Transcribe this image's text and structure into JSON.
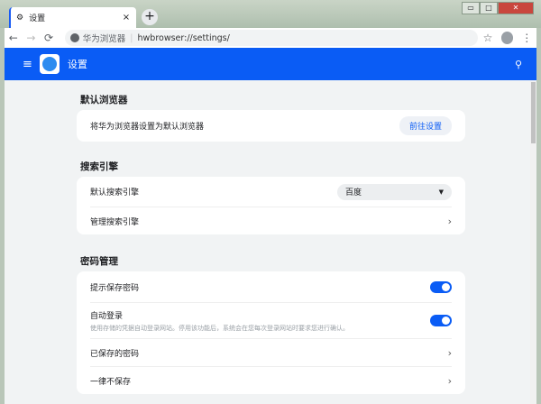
{
  "tab": {
    "title": "设置",
    "close": "×",
    "new_tab": "+"
  },
  "window": {
    "min": "▭",
    "max": "□",
    "close": "✕"
  },
  "toolbar": {
    "back": "←",
    "forward": "→",
    "reload": "⟳",
    "site_name": "华为浏览器",
    "separator": "|",
    "url": "hwbrowser://settings/",
    "star": "☆",
    "menu": "⋮"
  },
  "header": {
    "menu": "≡",
    "title": "设置",
    "search": "⚲"
  },
  "sections": [
    {
      "title": "默认浏览器",
      "rows": [
        {
          "label": "将华为浏览器设置为默认浏览器",
          "button": "前往设置"
        }
      ]
    },
    {
      "title": "搜索引擎",
      "rows": [
        {
          "label": "默认搜索引擎",
          "value": "百度",
          "arrow": "▼"
        },
        {
          "label": "管理搜索引擎",
          "chevron": "›"
        }
      ]
    },
    {
      "title": "密码管理",
      "rows": [
        {
          "label": "提示保存密码",
          "toggle": true
        },
        {
          "label": "自动登录",
          "sub": "使用存储的凭据自动登录网站。停用该功能后，系统会在您每次登录网站时要求您进行确认。",
          "toggle": true
        },
        {
          "label": "已保存的密码",
          "chevron": "›"
        },
        {
          "label": "一律不保存",
          "chevron": "›"
        }
      ]
    }
  ],
  "colors": {
    "accent": "#0a5cf5"
  }
}
